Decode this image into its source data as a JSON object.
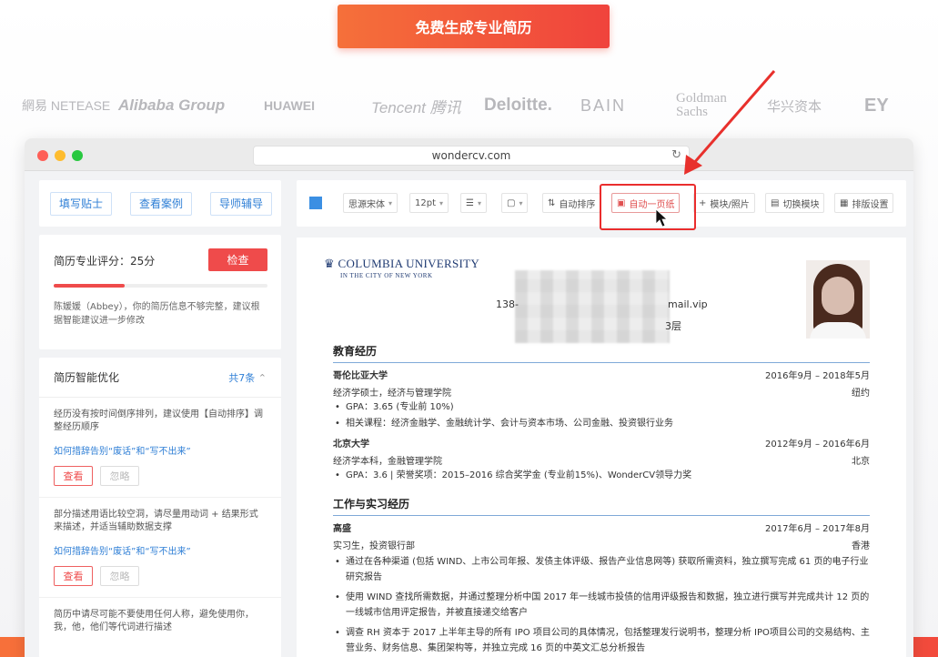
{
  "cta": {
    "label": "免费生成专业简历"
  },
  "logos": [
    "網易 NETEASE",
    "Alibaba Group",
    "HUAWEI",
    "Tencent 腾讯",
    "Deloitte.",
    "BAIN",
    "Goldman Sachs",
    "华兴资本",
    "EY"
  ],
  "browser": {
    "url": "wondercv.com"
  },
  "left": {
    "tips": [
      "填写贴士",
      "查看案例",
      "导师辅导"
    ],
    "score": {
      "label": "简历专业评分：25分",
      "check_label": "检查",
      "progress": 0.33,
      "message": "陈媛媛（Abbey），你的简历信息不够完整，建议根据智能建议进一步修改"
    },
    "optimize": {
      "title": "简历智能优化",
      "count": "共7条",
      "items": [
        {
          "text": "经历没有按时间倒序排列，建议使用【自动排序】调整经历顺序",
          "link": "如何措辞告别“废话”和“写不出来”",
          "view": "查看",
          "ignore": "忽略"
        },
        {
          "text": "部分描述用语比较空洞，请尽量用动词 + 结果形式来描述，并适当辅助数据支撑",
          "link": "如何措辞告别“废话”和“写不出来”",
          "view": "查看",
          "ignore": "忽略"
        },
        {
          "text": "简历中请尽可能不要使用任何人称，避免使用你，我，他，他们等代词进行描述"
        }
      ]
    }
  },
  "toolbar": {
    "color": "#3b8fe3",
    "font": "思源宋体",
    "size": "12pt",
    "auto_sort": "自动排序",
    "one_page": "自动一页纸",
    "modules": "模块/照片",
    "switch": "切换模块",
    "layout": "排版设置"
  },
  "resume": {
    "university": "COLUMBIA UNIVERSITY",
    "university_sub": "IN THE CITY OF NEW YORK",
    "phone": "138-",
    "email": "mail.vip",
    "address": "3层",
    "edu_title": "教育经历",
    "edu": [
      {
        "school": "哥伦比亚大学",
        "date": "2016年9月 – 2018年5月",
        "degree": "经济学硕士，经济与管理学院",
        "city": "纽约",
        "bullets": [
          "GPA：3.65 (专业前 10%)",
          "相关课程：经济金融学、金融统计学、会计与资本市场、公司金融、投资银行业务"
        ]
      },
      {
        "school": "北京大学",
        "date": "2012年9月 – 2016年6月",
        "degree": "经济学本科，金融管理学院",
        "city": "北京",
        "bullets": [
          "GPA：3.6 | 荣誉奖项：2015–2016 综合奖学金 (专业前15%)、WonderCV领导力奖"
        ]
      }
    ],
    "work_title": "工作与实习经历",
    "work": {
      "company": "高盛",
      "date": "2017年6月 – 2017年8月",
      "role": "实习生，投资银行部",
      "city": "香港",
      "bullets": [
        "通过在各种渠道 (包括 WIND、上市公司年报、发债主体评级、报告产业信息网等) 获取所需资料，独立撰写完成 61 页的电子行业研究报告",
        "使用 WIND 查找所需数据，并通过整理分析中国 2017 年一线城市投债的信用评级报告和数据，独立进行撰写并完成共计 12 页的一线城市信用评定报告，并被直接递交给客户",
        "调查 RH 资本于 2017 上半年主导的所有 IPO 项目公司的具体情况，包括整理发行说明书，整理分析 IPO项目公司的交易结构、主营业务、财务信息、集团架构等，并独立完成 16 页的中英文汇总分析报告"
      ]
    }
  }
}
